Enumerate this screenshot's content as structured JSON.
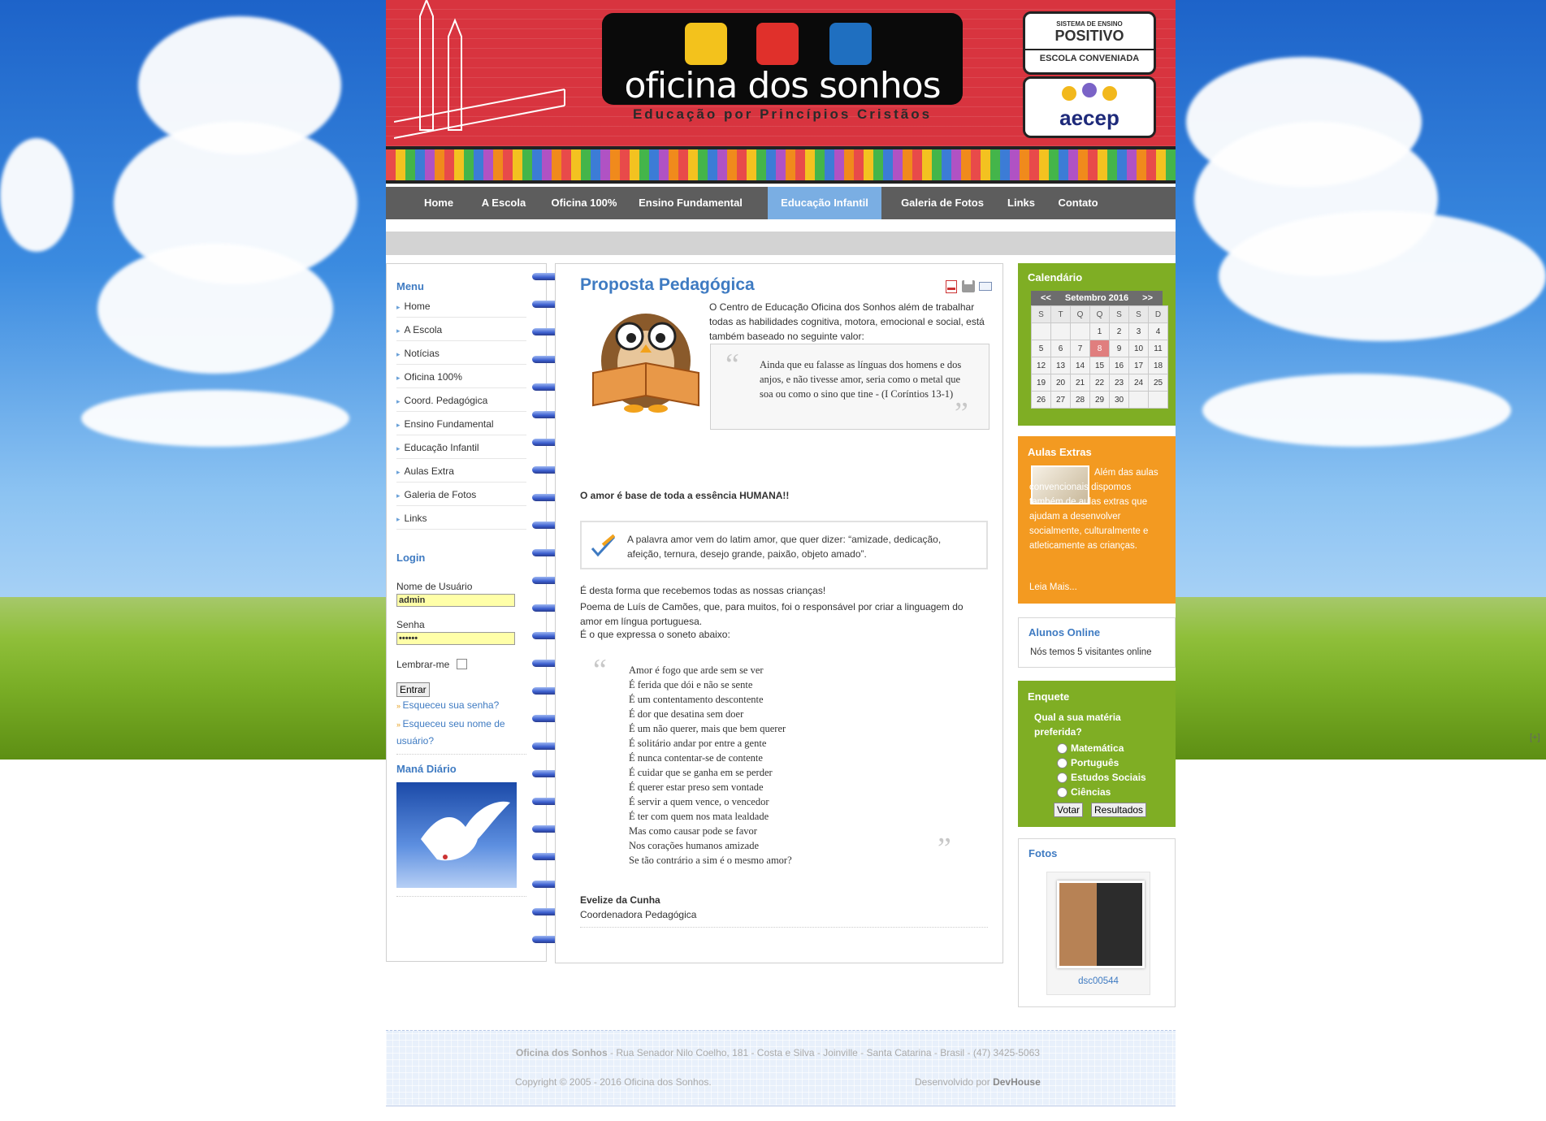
{
  "header": {
    "logo_text": "oficina dos sonhos",
    "logo_sub": "Educação por Princípios Cristãos",
    "badge1_top": "SISTEMA DE ENSINO",
    "badge1_main": "POSITIVO",
    "badge1_sub": "ESCOLA CONVENIADA",
    "badge2": "aecep"
  },
  "nav": {
    "items": [
      "Home",
      "A Escola",
      "Oficina 100%",
      "Ensino Fundamental",
      "Educação Infantil",
      "Galeria de Fotos",
      "Links",
      "Contato"
    ],
    "active": "Educação Infantil"
  },
  "left": {
    "menu_title": "Menu",
    "menu": [
      "Home",
      "A Escola",
      "Notícias",
      "Oficina 100%",
      "Coord. Pedagógica",
      "Ensino Fundamental",
      "Educação Infantil",
      "Aulas Extra",
      "Galeria de Fotos",
      "Links"
    ],
    "login_title": "Login",
    "user_label": "Nome de Usuário",
    "user_value": "admin",
    "pass_label": "Senha",
    "pass_value": "••••••",
    "remember_label": "Lembrar-me",
    "submit_label": "Entrar",
    "forgot_pass": "Esqueceu sua senha?",
    "forgot_user": "Esqueceu seu nome de usuário?",
    "mana_title": "Maná Diário"
  },
  "main": {
    "title": "Proposta Pedagógica",
    "intro": "O Centro de Educação Oficina dos Sonhos além de trabalhar todas as habilidades cognitiva, motora, emocional e social, está também baseado no seguinte valor:",
    "quote1": "Ainda que eu falasse as línguas dos homens e dos anjos, e não tivesse amor, seria como o metal que soa ou como o sino que tine - (I Coríntios 13-1)",
    "bold_line": "O amor é base de toda a essência HUMANA!!",
    "note": "A palavra amor vem do latim amor, que quer dizer: “amizade, dedicação, afeição, ternura, desejo grande, paixão, objeto amado”.",
    "para1": "É desta forma que recebemos todas as nossas crianças!",
    "para2": "Poema de Luís de Camões, que, para muitos, foi o responsável por criar a linguagem do amor em língua portuguesa.",
    "para3": "É o que expressa o soneto abaixo:",
    "poem": [
      "Amor é fogo que arde sem se ver",
      "É ferida que dói e não se sente",
      "É um contentamento descontente",
      "É dor que desatina sem doer",
      "É um não querer, mais que bem querer",
      "É solitário andar por entre a gente",
      "É nunca contentar-se de contente",
      "É cuidar que se ganha em se perder",
      "É querer estar preso sem vontade",
      "É servir a quem vence, o vencedor",
      "É ter com quem nos mata lealdade",
      "Mas como causar pode se favor",
      "Nos corações humanos amizade",
      "Se tão contrário a sim é o mesmo amor?"
    ],
    "author": "Evelize da Cunha",
    "author_role": "Coordenadora Pedagógica"
  },
  "right": {
    "calendar_title": "Calendário",
    "calendar_month": "Setembro 2016",
    "calendar_prev": "<<",
    "calendar_next": ">>",
    "weekdays": [
      "S",
      "T",
      "Q",
      "Q",
      "S",
      "S",
      "D"
    ],
    "weeks": [
      [
        "",
        "",
        "",
        "",
        "1",
        "2",
        "3",
        "4"
      ],
      [
        "5",
        "6",
        "7",
        "8",
        "9",
        "10",
        "11"
      ],
      [
        "12",
        "13",
        "14",
        "15",
        "16",
        "17",
        "18"
      ],
      [
        "19",
        "20",
        "21",
        "22",
        "23",
        "24",
        "25"
      ],
      [
        "26",
        "27",
        "28",
        "29",
        "30",
        "",
        ""
      ]
    ],
    "today": "8",
    "extras_title": "Aulas Extras",
    "extras_text": "Além das aulas convencionais dispomos também de aulas extras que ajudam a desenvolver socialmente, culturalmente e atleticamente as crianças.",
    "extras_link": "Leia Mais...",
    "online_title": "Alunos Online",
    "online_text": "Nós temos 5 visitantes online",
    "poll_title": "Enquete",
    "poll_question": "Qual a sua matéria preferida?",
    "poll_options": [
      "Matemática",
      "Português",
      "Estudos Sociais",
      "Ciências"
    ],
    "poll_vote": "Votar",
    "poll_results": "Resultados",
    "photos_title": "Fotos",
    "photo_caption": "dsc00544"
  },
  "footer": {
    "site": "Oficina dos Sonhos",
    "address": " - Rua Senador Nilo Coelho, 181 - Costa e Silva - Joinville - Santa Catarina - Brasil - (47) 3425-5063",
    "copyright": "Copyright © 2005 - 2016 Oficina dos Sonhos.",
    "dev_label": "Desenvolvido por ",
    "dev_name": "DevHouse"
  },
  "misc": {
    "expand_marker": "[+]"
  },
  "colors": {
    "header_red": "#d8343f",
    "nav_grey": "#5d5d5d",
    "nav_active": "#7aaee3",
    "link_blue": "#3f7bc2",
    "green": "#7fae24",
    "orange": "#f39a21"
  }
}
